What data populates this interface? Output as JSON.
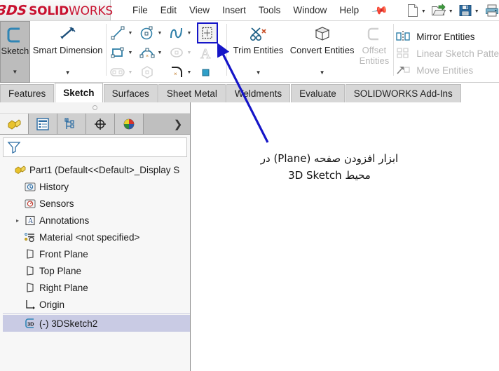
{
  "app": {
    "brand_primary": "3DS",
    "brand_bold": "SOLID",
    "brand_light": "WORKS",
    "accent_red": "#c8102e",
    "highlight_blue": "#1515c8"
  },
  "menubar": {
    "items": [
      {
        "label": "File"
      },
      {
        "label": "Edit"
      },
      {
        "label": "View"
      },
      {
        "label": "Insert"
      },
      {
        "label": "Tools"
      },
      {
        "label": "Window"
      },
      {
        "label": "Help"
      }
    ],
    "pin": "pin-icon",
    "quick_access": [
      {
        "name": "new-document-icon",
        "has_caret": true
      },
      {
        "name": "open-document-icon",
        "has_caret": true
      },
      {
        "name": "save-icon",
        "has_caret": true
      },
      {
        "name": "print-icon",
        "has_caret": true
      }
    ]
  },
  "ribbon": {
    "sketch": {
      "label": "Sketch",
      "selected": true,
      "has_caret": true
    },
    "smart_dimension": {
      "label": "Smart Dimension",
      "has_caret": true
    },
    "entities": [
      {
        "name": "line-icon",
        "caret": true,
        "dim": false,
        "selected": false
      },
      {
        "name": "circle-icon",
        "caret": true,
        "dim": false,
        "selected": false
      },
      {
        "name": "spline-icon",
        "caret": true,
        "dim": false,
        "selected": false
      },
      {
        "name": "plane-icon",
        "caret": false,
        "dim": false,
        "selected": true
      },
      {
        "name": "rectangle-icon",
        "caret": true,
        "dim": false,
        "selected": false
      },
      {
        "name": "arc-icon",
        "caret": true,
        "dim": false,
        "selected": false
      },
      {
        "name": "ellipse-icon",
        "caret": true,
        "dim": true,
        "selected": false
      },
      {
        "name": "text-icon",
        "caret": false,
        "dim": true,
        "selected": false
      },
      {
        "name": "slot-icon",
        "caret": true,
        "dim": true,
        "selected": false
      },
      {
        "name": "polygon-icon",
        "caret": false,
        "dim": true,
        "selected": false
      },
      {
        "name": "fillet-icon",
        "caret": true,
        "dim": false,
        "selected": false
      },
      {
        "name": "point-icon",
        "caret": false,
        "dim": false,
        "selected": false
      }
    ],
    "trim_entities": {
      "label": "Trim Entities",
      "has_caret": true
    },
    "convert_entities": {
      "label": "Convert Entities",
      "has_caret": true
    },
    "offset_entities": {
      "label_line1": "Offset",
      "label_line2": "Entities",
      "disabled": true
    },
    "right_commands": [
      {
        "label": "Mirror Entities",
        "icon": "mirror-entities-icon",
        "disabled": false
      },
      {
        "label": "Linear Sketch Patte",
        "icon": "linear-sketch-pattern-icon",
        "disabled": true
      },
      {
        "label": "Move Entities",
        "icon": "move-entities-icon",
        "disabled": true
      }
    ]
  },
  "tabs": [
    {
      "label": "Features",
      "active": false
    },
    {
      "label": "Sketch",
      "active": true
    },
    {
      "label": "Surfaces",
      "active": false
    },
    {
      "label": "Sheet Metal",
      "active": false
    },
    {
      "label": "Weldments",
      "active": false
    },
    {
      "label": "Evaluate",
      "active": false
    },
    {
      "label": "SOLIDWORKS Add-Ins",
      "active": false
    }
  ],
  "sidebar": {
    "panel_tabs": [
      {
        "name": "feature-manager-tree-icon",
        "active": true
      },
      {
        "name": "property-manager-icon",
        "active": false
      },
      {
        "name": "configuration-manager-icon",
        "active": false
      },
      {
        "name": "dimxpert-manager-icon",
        "active": false
      },
      {
        "name": "display-manager-icon",
        "active": false
      }
    ],
    "expand_icon": "chevron-right-icon",
    "filter_icon": "filter-icon",
    "tree": [
      {
        "label": "Part1  (Default<<Default>_Display S",
        "icon": "part-icon",
        "indent": 0,
        "arrow": false,
        "selected": false
      },
      {
        "label": "History",
        "icon": "history-icon",
        "indent": 1,
        "arrow": false,
        "selected": false
      },
      {
        "label": "Sensors",
        "icon": "sensors-icon",
        "indent": 1,
        "arrow": false,
        "selected": false
      },
      {
        "label": "Annotations",
        "icon": "annotations-icon",
        "indent": 1,
        "arrow": true,
        "selected": false
      },
      {
        "label": "Material <not specified>",
        "icon": "material-icon",
        "indent": 1,
        "arrow": false,
        "selected": false
      },
      {
        "label": "Front Plane",
        "icon": "plane-tree-icon",
        "indent": 1,
        "arrow": false,
        "selected": false
      },
      {
        "label": "Top Plane",
        "icon": "plane-tree-icon",
        "indent": 1,
        "arrow": false,
        "selected": false
      },
      {
        "label": "Right Plane",
        "icon": "plane-tree-icon",
        "indent": 1,
        "arrow": false,
        "selected": false
      },
      {
        "label": "Origin",
        "icon": "origin-icon",
        "indent": 1,
        "arrow": false,
        "selected": false
      },
      {
        "label": "(-) 3DSketch2",
        "icon": "3d-sketch-icon",
        "indent": 1,
        "arrow": false,
        "selected": true
      }
    ]
  },
  "annotation": {
    "line1": "ابزار افزودن صفحه (Plane) در",
    "line2": "محیط 3D Sketch",
    "arrow_color": "#1515c8"
  }
}
